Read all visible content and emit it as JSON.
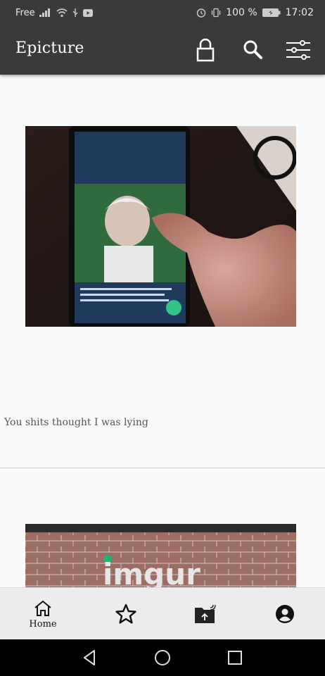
{
  "status_bar": {
    "carrier": "Free",
    "battery": "100 %",
    "time": "17:02"
  },
  "app_bar": {
    "title": "Epicture",
    "actions": [
      "lock-icon",
      "search-icon",
      "settings-sliders-icon"
    ]
  },
  "feed": {
    "posts": [
      {
        "caption": "You shits thought I was lying",
        "image_desc": "phone-screen-photo"
      },
      {
        "caption": "",
        "image_desc": "imgur-brick-wall"
      }
    ]
  },
  "bottom_nav": {
    "items": [
      {
        "label": "Home",
        "icon": "home-icon",
        "active": true
      },
      {
        "label": "",
        "icon": "star-icon"
      },
      {
        "label": "",
        "icon": "upload-folder-icon"
      },
      {
        "label": "",
        "icon": "account-icon"
      }
    ]
  },
  "imgur_text": "imgur",
  "colors": {
    "appbar": "#3a3a3a",
    "background": "#fafafa",
    "bottom_nav": "#ececec",
    "imgur_green": "#1bb76e"
  }
}
